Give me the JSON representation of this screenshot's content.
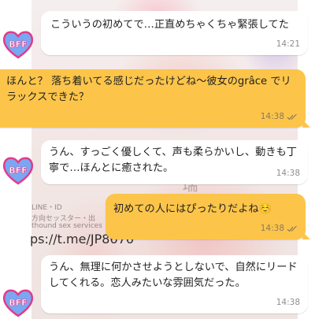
{
  "background": {
    "watermark_name": "瑞希",
    "watermark_lines": [
      "LINE・ID",
      "方向セッスター・出",
      "thound sex services"
    ],
    "watermark_url": "ps://t.me/JP8676"
  },
  "avatar": {
    "label": "BFF",
    "colors": {
      "fill": "#7aa7f2",
      "outline": "#e23b8b",
      "text": "#ffffff"
    }
  },
  "colors": {
    "incoming_bubble": "#ffffff",
    "outgoing_bubble": "#fcc54a"
  },
  "messages": [
    {
      "direction": "incoming",
      "text": "こういうの初めてで…正直めちゃくちゃ緊張してた",
      "time": "14:21"
    },
    {
      "direction": "outgoing",
      "text": "ほんと？ 落ち着いてる感じだったけどね～彼女のgrâce でリラックスできた？",
      "time": "14:38",
      "status_icon": "double-check-icon"
    },
    {
      "direction": "incoming",
      "text": "うん、すっごく優しくて、声も柔らかいし、動きも丁寧で…ほんとに癒された。",
      "time": "14:38"
    },
    {
      "direction": "outgoing",
      "text": "初めての人にはぴったりだよね☺️",
      "time": "14:38",
      "status_icon": "double-check-icon"
    },
    {
      "direction": "incoming",
      "text": "うん、無理に何かさせようとしないで、自然にリードしてくれる。恋人みたいな雰囲気だった。",
      "time": "14:38"
    }
  ]
}
